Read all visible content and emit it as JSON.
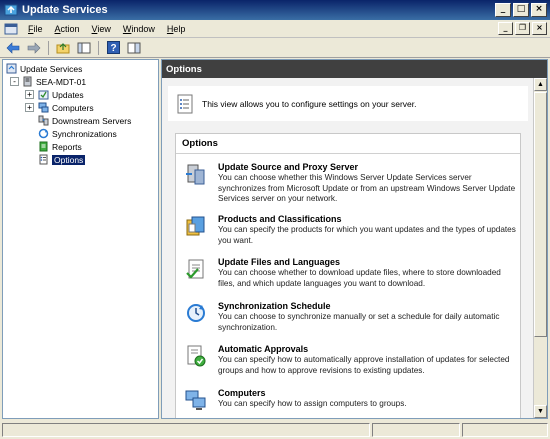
{
  "window": {
    "title": "Update Services"
  },
  "menu": {
    "items": [
      {
        "accel": "F",
        "rest": "ile"
      },
      {
        "accel": "A",
        "rest": "ction"
      },
      {
        "accel": "V",
        "rest": "iew"
      },
      {
        "accel": "W",
        "rest": "indow"
      },
      {
        "accel": "H",
        "rest": "elp"
      }
    ]
  },
  "tree": {
    "root": "Update Services",
    "server": "SEA-MDT-01",
    "children": [
      "Updates",
      "Computers",
      "Downstream Servers",
      "Synchronizations",
      "Reports",
      "Options"
    ],
    "selected": "Options"
  },
  "content": {
    "header": "Options",
    "info": "This view allows you to configure settings on your server.",
    "panel_title": "Options",
    "options": [
      {
        "title": "Update Source and Proxy Server",
        "desc": "You can choose whether this Windows Server Update Services server synchronizes from Microsoft Update or from an upstream Windows Server Update Services server on your network.",
        "icon": "server-source-icon"
      },
      {
        "title": "Products and Classifications",
        "desc": "You can specify the products for which you want updates and the types of updates you want.",
        "icon": "products-icon"
      },
      {
        "title": "Update Files and Languages",
        "desc": "You can choose whether to download update files, where to store downloaded files, and which update languages you want to download.",
        "icon": "update-files-icon"
      },
      {
        "title": "Synchronization Schedule",
        "desc": "You can choose to synchronize manually or set a schedule for daily automatic synchronization.",
        "icon": "sync-schedule-icon"
      },
      {
        "title": "Automatic Approvals",
        "desc": "You can specify how to automatically approve installation of updates for selected groups and how to approve revisions to existing updates.",
        "icon": "auto-approval-icon"
      },
      {
        "title": "Computers",
        "desc": "You can specify how to assign computers to groups.",
        "icon": "computers-icon"
      }
    ]
  },
  "colors": {
    "titlebar": "#0a246a",
    "header_bg": "#404040",
    "selection": "#0a246a"
  }
}
